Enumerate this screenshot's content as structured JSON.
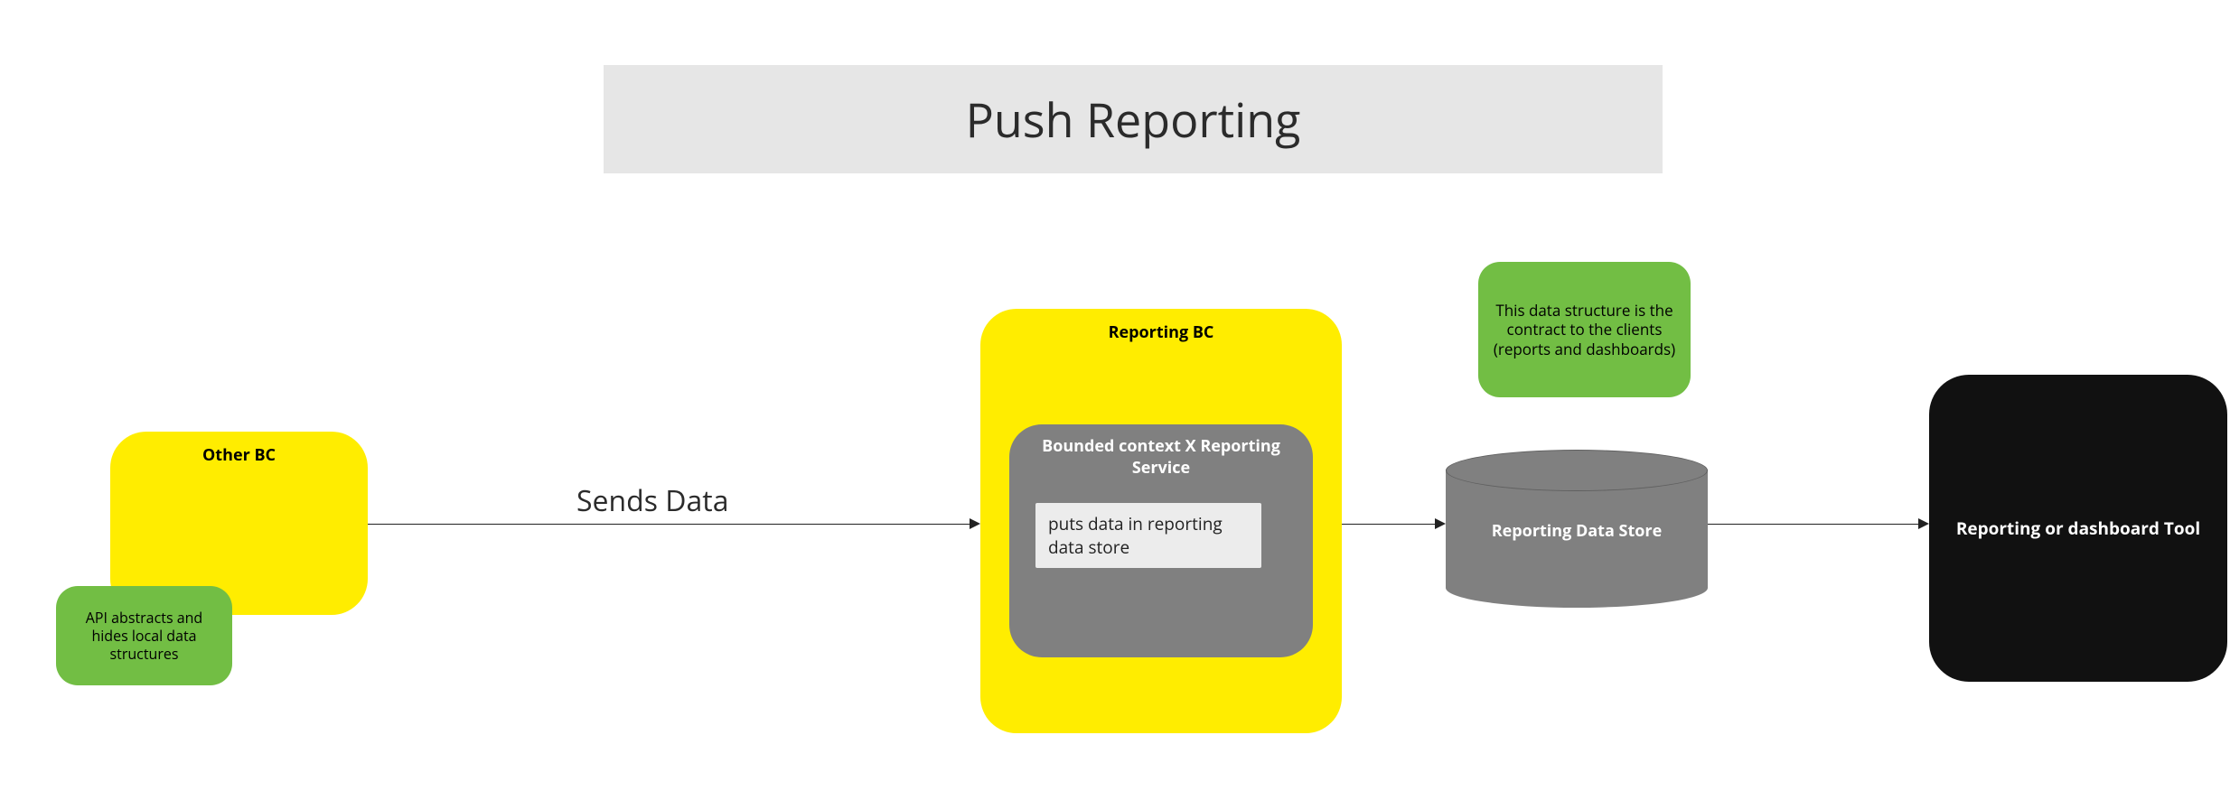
{
  "title": "Push Reporting",
  "nodes": {
    "other_bc": {
      "label": "Other BC"
    },
    "api_note": {
      "text": "API abstracts and hides local data structures"
    },
    "reporting_bc": {
      "label": "Reporting BC"
    },
    "reporting_service": {
      "label": "Bounded context X Reporting Service",
      "inner_text": "puts data in reporting data store"
    },
    "data_store": {
      "label": "Reporting Data Store"
    },
    "contract_note": {
      "text": "This data structure is the contract to the clients (reports and dashboards)"
    },
    "tool": {
      "label": "Reporting or dashboard Tool"
    }
  },
  "edges": {
    "sends_data": {
      "label": "Sends Data"
    }
  }
}
